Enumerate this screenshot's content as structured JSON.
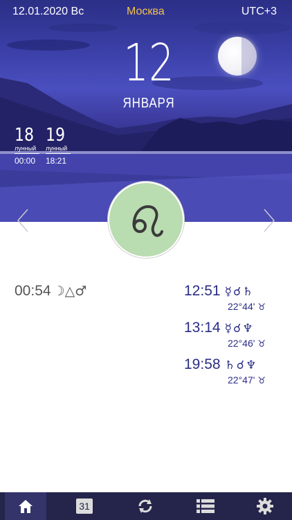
{
  "header": {
    "date": "12.01.2020 Вс",
    "city": "Москва",
    "timezone": "UTC+3"
  },
  "hero": {
    "day_number": "12",
    "month": "ЯНВАРЯ",
    "lunar_days": [
      {
        "number": "18",
        "label": "лунный",
        "time": "00:00"
      },
      {
        "number": "19",
        "label": "лунный",
        "time": "18:21"
      }
    ],
    "zodiac_icon": "leo-icon"
  },
  "events_left": [
    {
      "time": "00:54",
      "aspect": "☽△♂"
    }
  ],
  "events_right": [
    {
      "time": "12:51",
      "aspect": "☿☌♄",
      "degree": "22°44'",
      "sign": "♉"
    },
    {
      "time": "13:14",
      "aspect": "☿☌♆",
      "degree": "22°46'",
      "sign": "♉"
    },
    {
      "time": "19:58",
      "aspect": "♄☌♆",
      "degree": "22°47'",
      "sign": "♉"
    }
  ],
  "tabbar": {
    "tabs": [
      {
        "icon": "home-icon",
        "active": true
      },
      {
        "icon": "calendar-icon",
        "label": "31"
      },
      {
        "icon": "refresh-icon"
      },
      {
        "icon": "list-icon"
      },
      {
        "icon": "gear-icon"
      }
    ]
  },
  "colors": {
    "accent_city": "#f2c14e",
    "event_text": "#2a2d86",
    "tabbar_bg": "#25244a",
    "zodiac_bg": "#b9dcb1"
  }
}
